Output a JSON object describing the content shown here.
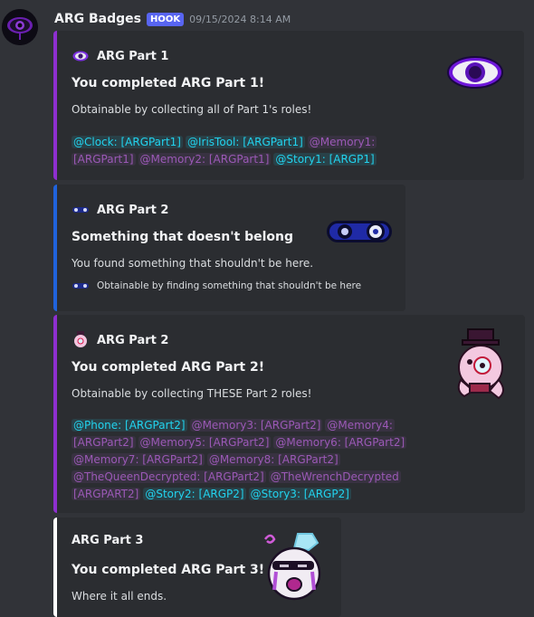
{
  "message": {
    "username": "ARG Badges",
    "badge": "HOOK",
    "timestamp": "09/15/2024 8:14 AM"
  },
  "embeds": [
    {
      "author": "ARG Part 1",
      "title": "You completed ARG Part 1!",
      "description": "Obtainable by collecting all of Part 1's roles!",
      "roles_line1": [
        {
          "text": "@Clock: [ARGPart1]",
          "color": "cyan"
        },
        {
          "text": "@IrisTool: [ARGPart1]",
          "color": "cyan"
        },
        {
          "text": "@Memory1:",
          "color": "purple"
        }
      ],
      "roles_line2": [
        {
          "text": "[ARGPart1]",
          "color": "purple"
        },
        {
          "text": "@Memory2: [ARGPart1]",
          "color": "purple"
        },
        {
          "text": "@Story1: [ARGP1]",
          "color": "cyan"
        }
      ],
      "thumbnail": "purple-eye-icon"
    },
    {
      "author": "ARG Part 2",
      "title": "Something that doesn't belong",
      "description": "You found something that shouldn't be here.",
      "footer": "Obtainable by finding something that shouldn't be here",
      "thumbnail": "scroll-eye-icon"
    },
    {
      "author": "ARG Part 2",
      "title": "You completed ARG Part 2!",
      "description": "Obtainable by collecting THESE Part 2 roles!",
      "roles_lines": [
        [
          {
            "text": "@Phone: [ARGPart2]",
            "color": "cyan"
          },
          {
            "text": "@Memory3: [ARGPart2]",
            "color": "purple"
          },
          {
            "text": "@Memory4:",
            "color": "purple"
          }
        ],
        [
          {
            "text": "[ARGPart2]",
            "color": "purple"
          },
          {
            "text": "@Memory5: [ARGPart2]",
            "color": "purple"
          },
          {
            "text": "@Memory6: [ARGPart2]",
            "color": "purple"
          }
        ],
        [
          {
            "text": "@Memory7: [ARGPart2]",
            "color": "purple"
          },
          {
            "text": "@Memory8: [ARGPart2]",
            "color": "purple"
          }
        ],
        [
          {
            "text": "@TheQueenDecrypted: [ARGPart2]",
            "color": "purple"
          },
          {
            "text": "@TheWrenchDecrypted",
            "color": "purple"
          }
        ],
        [
          {
            "text": "[ARGPART2]",
            "color": "purple"
          },
          {
            "text": "@Story2: [ARGP2]",
            "color": "cyan"
          },
          {
            "text": "@Story3: [ARGP2]",
            "color": "cyan"
          }
        ]
      ],
      "thumbnail": "pink-creature-icon"
    },
    {
      "author": "ARG Part 3",
      "title": "You completed ARG Part 3!",
      "description": "Where it all ends.",
      "thumbnail": "crying-face-icon"
    }
  ]
}
